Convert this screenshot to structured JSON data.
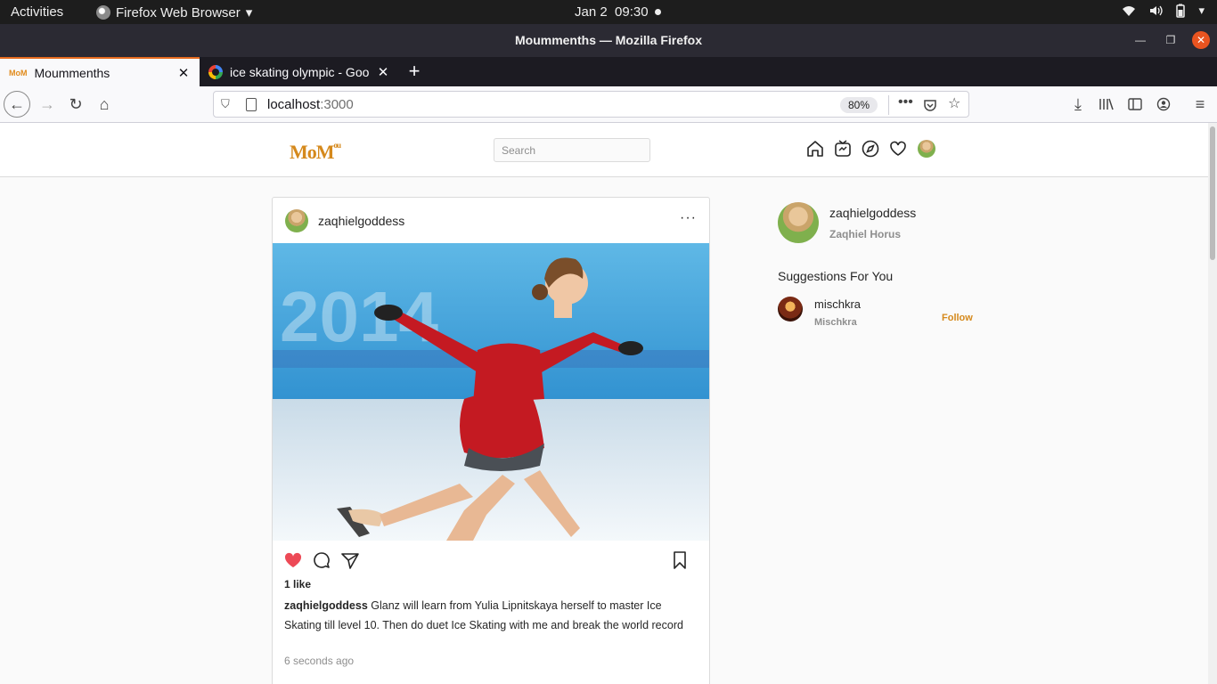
{
  "system_bar": {
    "activities": "Activities",
    "app_name": "Firefox Web Browser",
    "date": "Jan 2",
    "time": "09:30"
  },
  "window": {
    "title": "Moummenths — Mozilla Firefox"
  },
  "tabs": [
    {
      "title": "Moummenths",
      "active": true
    },
    {
      "title": "ice skating olympic - Goo",
      "active": false
    }
  ],
  "urlbar": {
    "host": "localhost",
    "port": ":3000",
    "zoom": "80%"
  },
  "site": {
    "logo": "MoM",
    "logo_sub": "ou",
    "search_placeholder": "Search"
  },
  "post": {
    "username": "zaqhielgoddess",
    "more": "···",
    "likes": "1 like",
    "caption_user": "zaqhielgoddess",
    "caption_text": "Glanz will learn from Yulia Lipnitskaya herself to master Ice Skating till level 10. Then do duet Ice Skating with me and break the world record",
    "time": "6 seconds ago",
    "liked": true,
    "image_banner": "2014"
  },
  "sidebar": {
    "username": "zaqhielgoddess",
    "fullname": "Zaqhiel Horus",
    "suggestions_title": "Suggestions For You",
    "suggestions": [
      {
        "username": "mischkra",
        "name": "Mischkra",
        "action": "Follow"
      }
    ]
  },
  "colors": {
    "accent": "#d5891c",
    "like": "#ed4956",
    "tab_highlight": "#e56b1f"
  }
}
